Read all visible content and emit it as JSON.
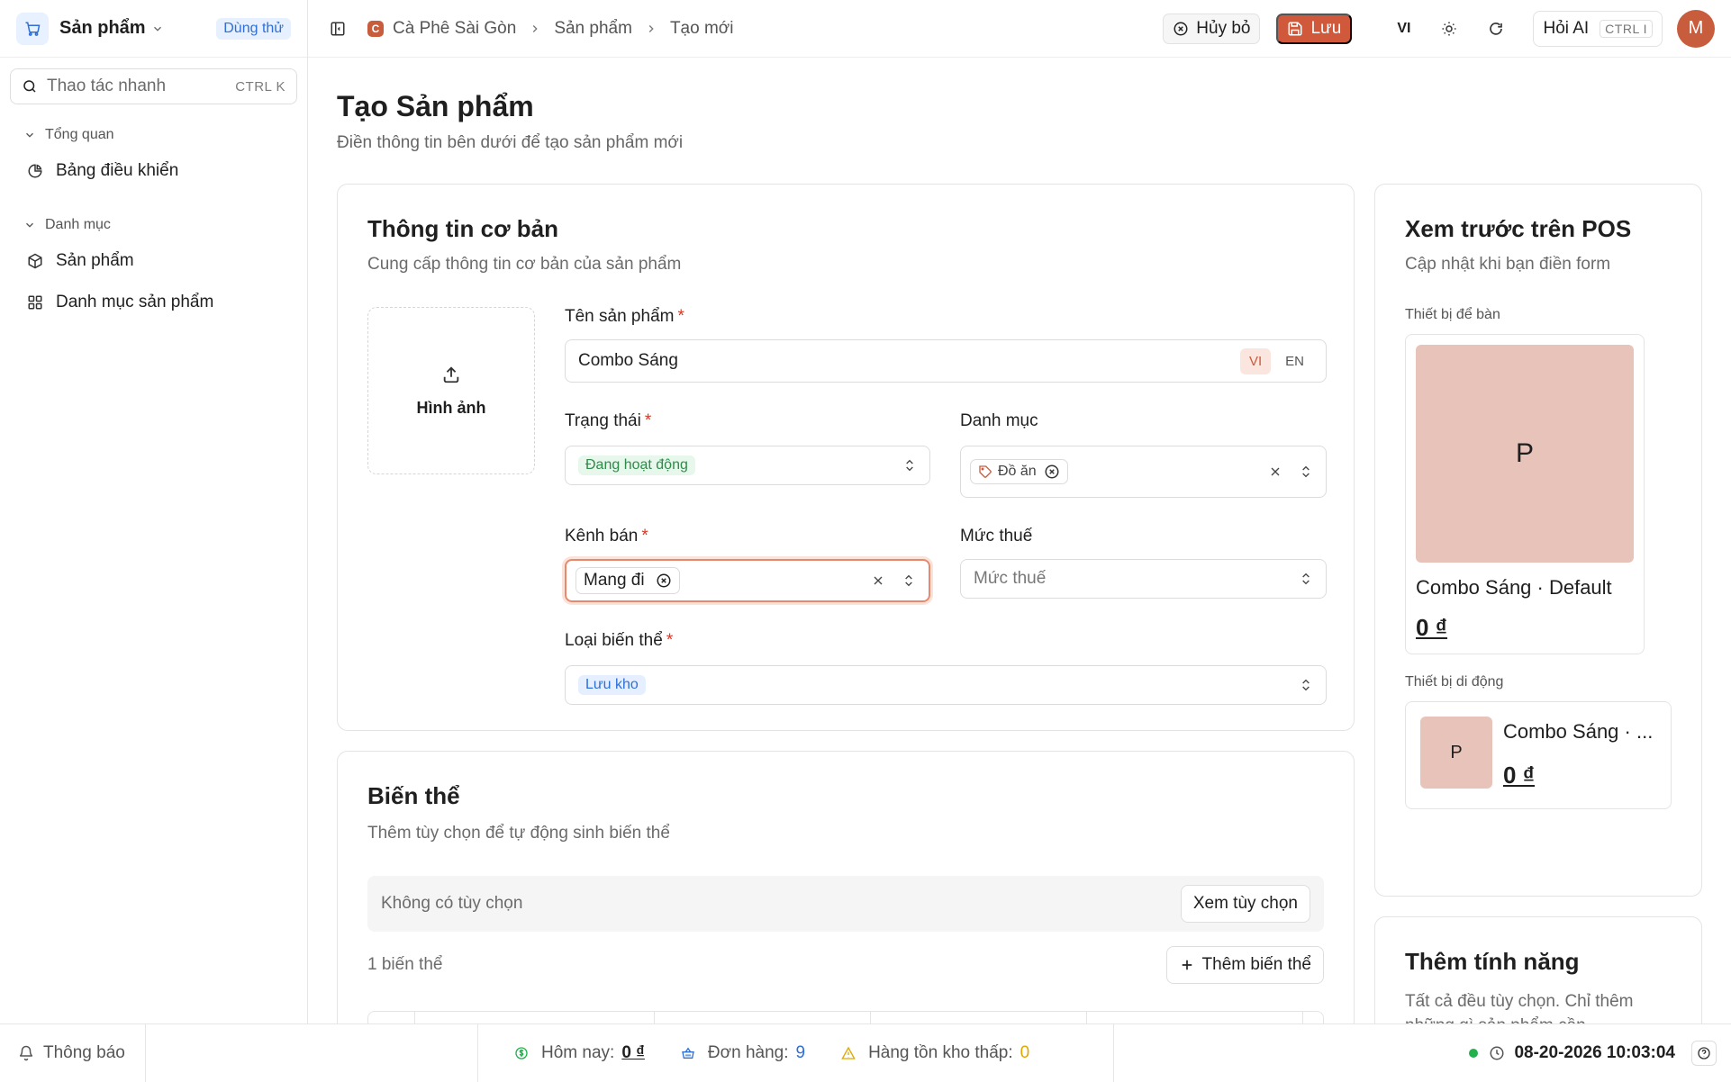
{
  "sidebar": {
    "app_name": "Sản phẩm",
    "trial_badge": "Dùng thử",
    "quick_action": {
      "placeholder": "Thao tác nhanh",
      "shortcut": "CTRL K"
    },
    "sections": [
      {
        "label": "Tổng quan",
        "items": [
          {
            "label": "Bảng điều khiển",
            "icon": "pie-chart-icon"
          }
        ]
      },
      {
        "label": "Danh mục",
        "items": [
          {
            "label": "Sản phẩm",
            "icon": "box-icon"
          },
          {
            "label": "Danh mục sản phẩm",
            "icon": "grid-icon"
          }
        ]
      }
    ]
  },
  "topbar": {
    "breadcrumbs": [
      "Cà Phê Sài Gòn",
      "Sản phẩm",
      "Tạo mới"
    ],
    "store_initial": "C",
    "cancel_label": "Hủy bỏ",
    "save_label": "Lưu",
    "language": "VI",
    "ask_ai_label": "Hỏi AI",
    "ask_ai_shortcut": "CTRL I",
    "avatar_initial": "M"
  },
  "page": {
    "title": "Tạo Sản phẩm",
    "subtitle": "Điền thông tin bên dưới để tạo sản phẩm mới"
  },
  "basic_info": {
    "title": "Thông tin cơ bản",
    "subtitle": "Cung cấp thông tin cơ bản của sản phẩm",
    "image_label": "Hình ảnh",
    "name_label": "Tên sản phẩm",
    "name_value": "Combo Sáng",
    "lang_vi": "VI",
    "lang_en": "EN",
    "status_label": "Trạng thái",
    "status_value": "Đang hoạt động",
    "category_label": "Danh mục",
    "category_chip": "Đồ ăn",
    "channel_label": "Kênh bán",
    "channel_chip": "Mang đi",
    "tax_label": "Mức thuế",
    "tax_placeholder": "Mức thuế",
    "variant_type_label": "Loại biến thể",
    "variant_type_value": "Lưu kho",
    "required_mark": "*"
  },
  "variants": {
    "title": "Biến thể",
    "subtitle": "Thêm tùy chọn để tự động sinh biến thể",
    "no_options": "Không có tùy chọn",
    "view_options_label": "Xem tùy chọn",
    "count_label": "1 biến thể",
    "add_variant_label": "Thêm biến thể"
  },
  "preview": {
    "title": "Xem trước trên POS",
    "subtitle": "Cập nhật khi bạn điền form",
    "desktop_label": "Thiết bị để bàn",
    "tile_letter": "P",
    "desktop_name": "Combo Sáng · Default",
    "price": "0 ₫",
    "mobile_label": "Thiết bị di động",
    "mobile_name": "Combo Sáng · ...",
    "tile_color": "#e7c3b9"
  },
  "features": {
    "title": "Thêm tính năng",
    "subtitle": "Tất cả đều tùy chọn. Chỉ thêm những gì sản phẩm cần."
  },
  "footer": {
    "notifications": "Thông báo",
    "today_label": "Hôm nay:",
    "today_value": "0 ₫",
    "orders_label": "Đơn hàng:",
    "orders_value": "9",
    "low_stock_label": "Hàng tồn kho thấp:",
    "low_stock_value": "0",
    "datetime": "08-20-2026 10:03:04"
  },
  "colors": {
    "accent": "#d0593b",
    "status_online": "#22b14c",
    "link_blue": "#2f6fd6",
    "warning": "#e0a800"
  }
}
